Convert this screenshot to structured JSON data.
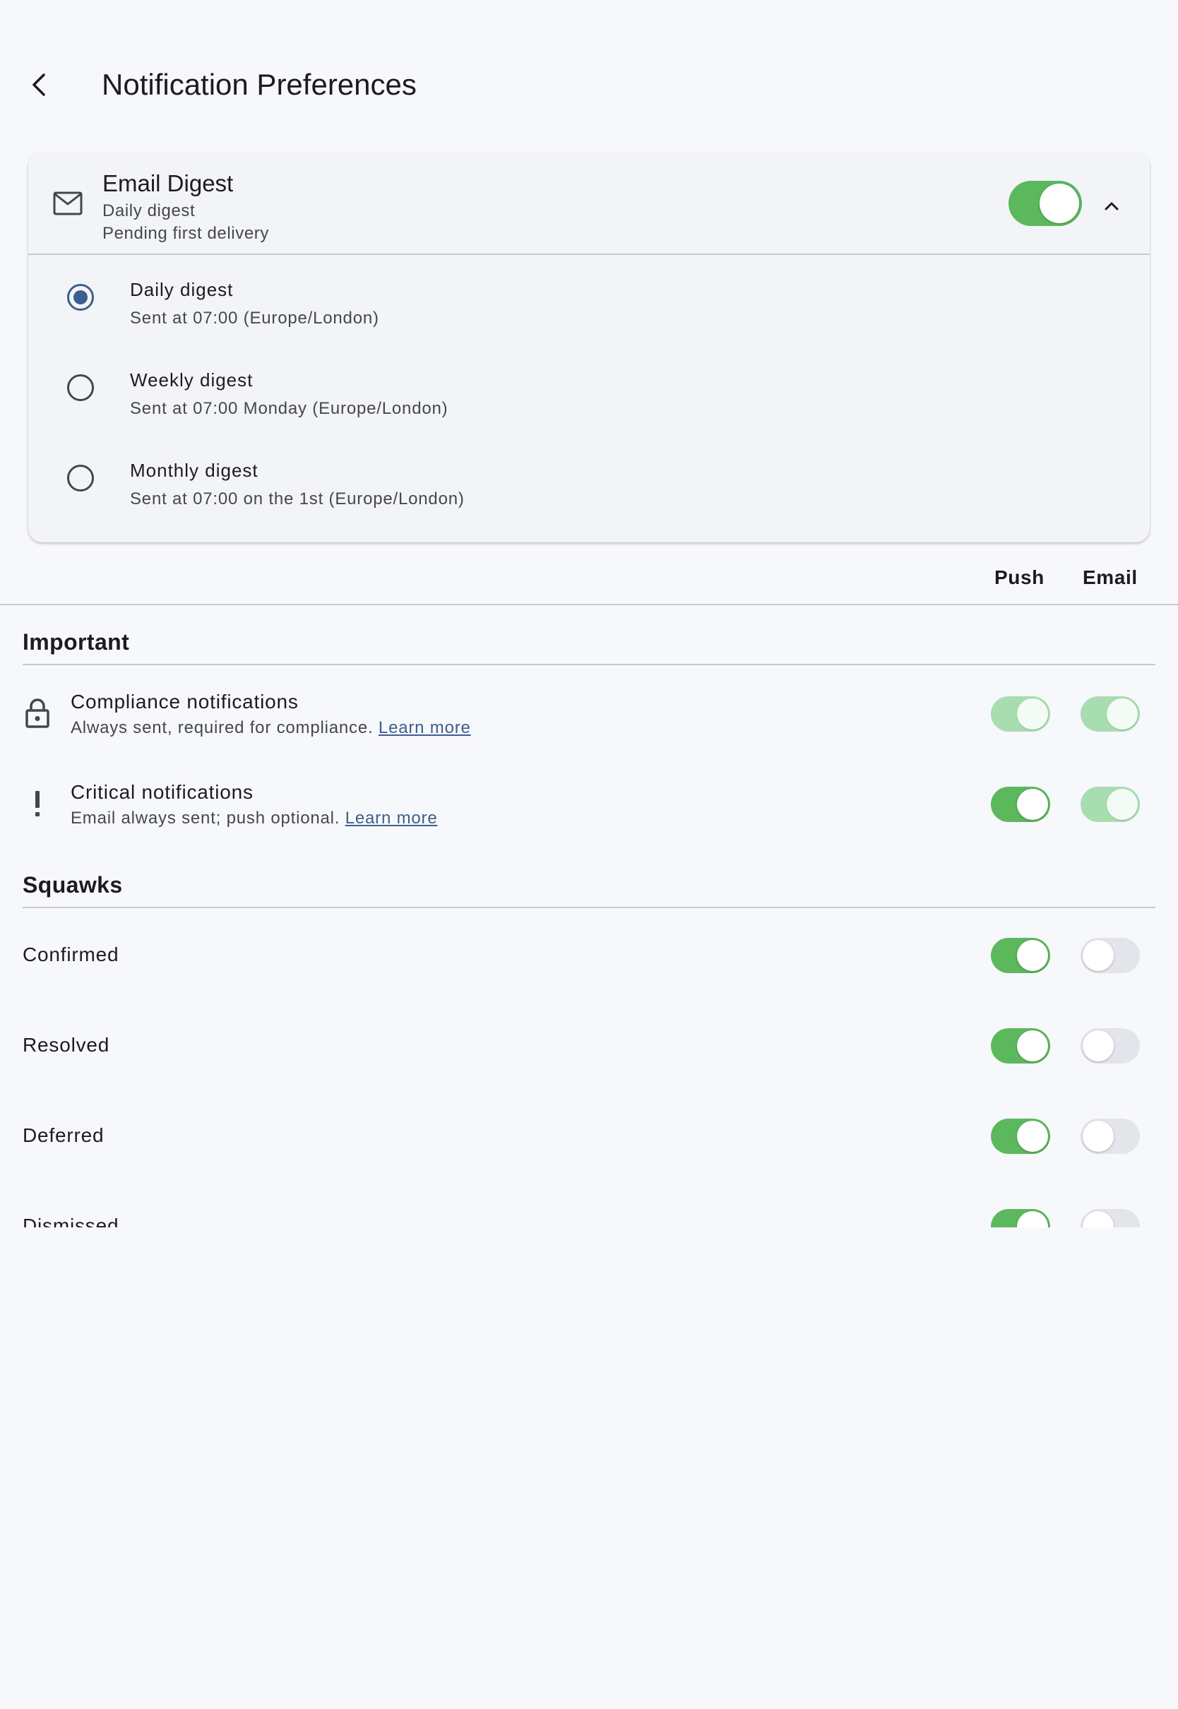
{
  "header": {
    "title": "Notification Preferences",
    "back_icon": "arrow-back-icon"
  },
  "digest": {
    "title": "Email Digest",
    "subtitle": "Daily digest",
    "status": "Pending first delivery",
    "enabled": true,
    "expanded": true,
    "icon": "mail-icon",
    "options": [
      {
        "label": "Daily digest",
        "description": "Sent at 07:00 (Europe/London)",
        "selected": true
      },
      {
        "label": "Weekly digest",
        "description": "Sent at 07:00 Monday (Europe/London)",
        "selected": false
      },
      {
        "label": "Monthly digest",
        "description": "Sent at 07:00 on the 1st (Europe/London)",
        "selected": false
      }
    ]
  },
  "columns": {
    "push": "Push",
    "email": "Email"
  },
  "sections": {
    "important": {
      "title": "Important",
      "rows": [
        {
          "label": "Compliance notifications",
          "description": "Always sent, required for compliance.",
          "link": "Learn more",
          "icon": "lock-icon",
          "push": "on-disabled",
          "email": "on-disabled"
        },
        {
          "label": "Critical notifications",
          "description": "Email always sent; push optional.",
          "link": "Learn more",
          "icon": "exclamation-icon",
          "push": "on",
          "email": "on-disabled"
        }
      ]
    },
    "squawks": {
      "title": "Squawks",
      "rows": [
        {
          "label": "Confirmed",
          "push": "on",
          "email": "off"
        },
        {
          "label": "Resolved",
          "push": "on",
          "email": "off"
        },
        {
          "label": "Deferred",
          "push": "on",
          "email": "off"
        },
        {
          "label": "Dismissed",
          "push": "on",
          "email": "off"
        }
      ]
    }
  },
  "colors": {
    "accent": "#3d5f8c",
    "toggle_on": "#5cb85c",
    "toggle_on_disabled": "#a8ddb0",
    "toggle_off": "#e4e5ea",
    "background": "#f7f8fc"
  }
}
